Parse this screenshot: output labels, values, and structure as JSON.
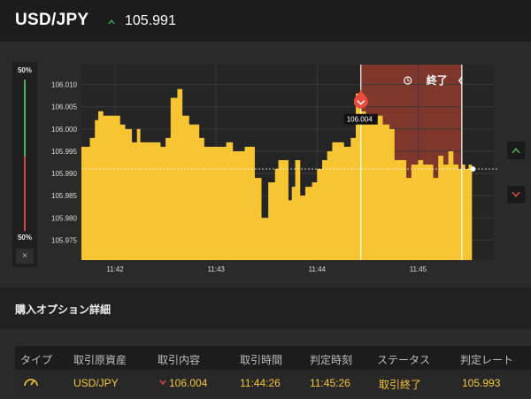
{
  "header": {
    "pair": "USD/JPY",
    "rate": "105.991",
    "trend": "up",
    "trend_color": "#4caf50"
  },
  "gauge": {
    "top_label": "50%",
    "bottom_label": "50%",
    "up_share": 0.5,
    "down_share": 0.5,
    "close_label": "×"
  },
  "chart_data": {
    "type": "area",
    "color": "#f7c531",
    "x_ticks": [
      "11:42",
      "11:43",
      "11:44",
      "11:45"
    ],
    "y_ticks": [
      "106.010",
      "106.005",
      "106.000",
      "105.995",
      "105.990",
      "105.985",
      "105.980",
      "105.975"
    ],
    "ylim": [
      105.9705,
      106.0145
    ],
    "current_rate": 105.991,
    "x_start": "11:41:40",
    "x_end": "11:45:45",
    "x": [
      "11:41:40",
      "11:41:45",
      "11:41:48",
      "11:41:50",
      "11:41:53",
      "11:41:56",
      "11:42:00",
      "11:42:03",
      "11:42:06",
      "11:42:10",
      "11:42:13",
      "11:42:15",
      "11:42:18",
      "11:42:20",
      "11:42:24",
      "11:42:27",
      "11:42:30",
      "11:42:33",
      "11:42:37",
      "11:42:40",
      "11:42:44",
      "11:42:47",
      "11:42:50",
      "11:42:53",
      "11:42:57",
      "11:43:00",
      "11:43:03",
      "11:43:06",
      "11:43:10",
      "11:43:14",
      "11:43:17",
      "11:43:20",
      "11:43:23",
      "11:43:27",
      "11:43:31",
      "11:43:35",
      "11:43:37",
      "11:43:40",
      "11:43:43",
      "11:43:45",
      "11:43:47",
      "11:43:50",
      "11:43:53",
      "11:43:57",
      "11:44:00",
      "11:44:03",
      "11:44:06",
      "11:44:09",
      "11:44:12",
      "11:44:16",
      "11:44:20",
      "11:44:23",
      "11:44:26",
      "11:44:29",
      "11:44:33",
      "11:44:36",
      "11:44:39",
      "11:44:43",
      "11:44:46",
      "11:44:49",
      "11:44:53",
      "11:44:56",
      "11:45:00",
      "11:45:03",
      "11:45:06",
      "11:45:09",
      "11:45:12",
      "11:45:15",
      "11:45:18",
      "11:45:21",
      "11:45:24",
      "11:45:26",
      "11:45:28",
      "11:45:30",
      "11:45:32"
    ],
    "y": [
      105.996,
      105.998,
      106.002,
      106.004,
      106.003,
      106.003,
      106.003,
      106.001,
      106.0,
      105.997,
      106.0,
      105.997,
      105.997,
      105.997,
      105.997,
      105.996,
      105.998,
      106.007,
      106.009,
      106.003,
      106.001,
      106.001,
      105.998,
      105.996,
      105.996,
      105.996,
      105.996,
      105.997,
      105.995,
      105.995,
      105.996,
      105.996,
      105.989,
      105.98,
      105.988,
      105.991,
      105.993,
      105.993,
      105.984,
      105.987,
      105.993,
      105.985,
      105.987,
      105.988,
      105.991,
      105.993,
      105.995,
      105.997,
      105.997,
      105.996,
      105.998,
      106.008,
      106.004,
      106.003,
      106.002,
      106.003,
      106.001,
      106.0,
      105.993,
      105.993,
      105.989,
      105.992,
      105.993,
      105.992,
      105.992,
      105.989,
      105.994,
      105.992,
      105.995,
      105.992,
      105.991,
      105.992,
      105.991,
      105.992,
      105.991
    ],
    "entry": {
      "time": "11:44:26",
      "value": 106.004,
      "label": "106.004",
      "direction": "down"
    },
    "expiry_time": "11:45:26",
    "expired_label": "終了",
    "expired_color": "#8b3a2c"
  },
  "side_buttons": {
    "up_color": "#4caf50",
    "down_color": "#d0493f"
  },
  "details": {
    "title": "購入オプション詳細",
    "columns": [
      "タイプ",
      "取引原資産",
      "取引内容",
      "取引時間",
      "判定時刻",
      "ステータス",
      "判定レート"
    ],
    "row": {
      "type_icon": "gauge-icon",
      "asset": "USD/JPY",
      "direction": "down",
      "content": "106.004",
      "trade_time": "11:44:26",
      "judge_time": "11:45:26",
      "status": "取引終了",
      "judge_rate": "105.993"
    }
  }
}
